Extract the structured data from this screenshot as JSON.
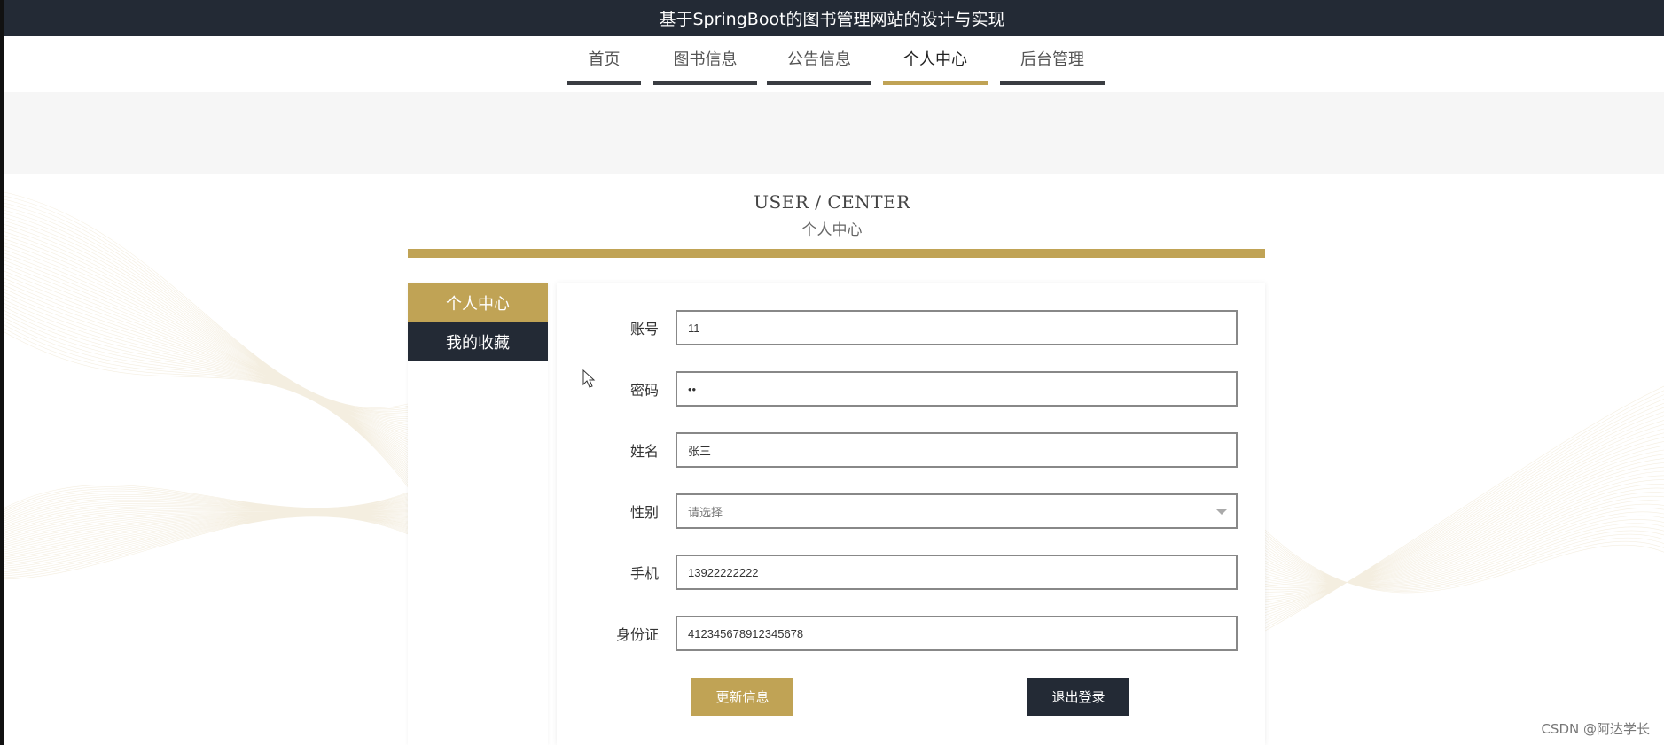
{
  "app": {
    "title": "基于SpringBoot的图书管理网站的设计与实现"
  },
  "nav": {
    "items": [
      {
        "label": "首页",
        "active": false
      },
      {
        "label": "图书信息",
        "active": false
      },
      {
        "label": "公告信息",
        "active": false
      },
      {
        "label": "个人中心",
        "active": true
      },
      {
        "label": "后台管理",
        "active": false
      }
    ]
  },
  "section": {
    "title_en": "USER / CENTER",
    "title_cn": "个人中心"
  },
  "sidebar": {
    "items": [
      {
        "label": "个人中心",
        "active": true
      },
      {
        "label": "我的收藏",
        "active": false
      }
    ]
  },
  "form": {
    "account": {
      "label": "账号",
      "value": "11"
    },
    "password": {
      "label": "密码",
      "value": "••"
    },
    "name": {
      "label": "姓名",
      "value": "张三"
    },
    "gender": {
      "label": "性别",
      "placeholder": "请选择"
    },
    "phone": {
      "label": "手机",
      "value": "13922222222"
    },
    "id_card": {
      "label": "身份证",
      "value": "412345678912345678"
    },
    "update_label": "更新信息",
    "logout_label": "退出登录"
  },
  "watermark": "CSDN @阿达学长",
  "colors": {
    "accent_gold": "#c0a355",
    "dark": "#232a35"
  }
}
